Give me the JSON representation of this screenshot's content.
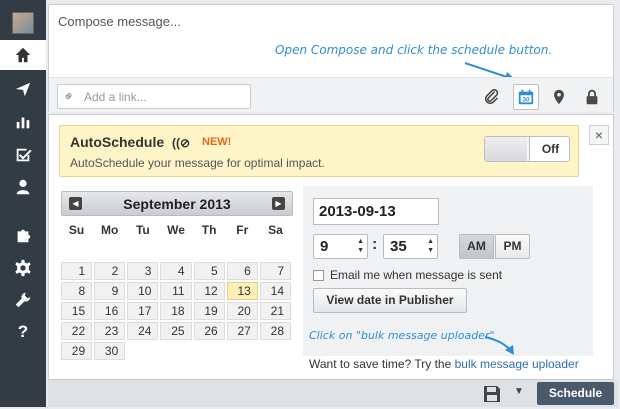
{
  "compose": {
    "placeholder": "Compose message...",
    "hint": "Open Compose and click the schedule button.",
    "link_placeholder": "Add a link..."
  },
  "autoschedule": {
    "title": "AutoSchedule",
    "new_badge": "NEW!",
    "description": "AutoSchedule your message for optimal impact.",
    "toggle_label": "Off"
  },
  "calendar": {
    "month": "September 2013",
    "weekdays": [
      "Su",
      "Mo",
      "Tu",
      "We",
      "Th",
      "Fr",
      "Sa"
    ],
    "weeks": [
      [
        "",
        "",
        "",
        "",
        "",
        "",
        ""
      ],
      [
        "1",
        "2",
        "3",
        "4",
        "5",
        "6",
        "7"
      ],
      [
        "8",
        "9",
        "10",
        "11",
        "12",
        "13",
        "14"
      ],
      [
        "15",
        "16",
        "17",
        "18",
        "19",
        "20",
        "21"
      ],
      [
        "22",
        "23",
        "24",
        "25",
        "26",
        "27",
        "28"
      ],
      [
        "29",
        "30",
        "",
        "",
        "",
        "",
        ""
      ]
    ],
    "selected_day": "13"
  },
  "time": {
    "date": "2013-09-13",
    "hour": "9",
    "minute": "35",
    "am": "AM",
    "pm": "PM",
    "email_label": "Email me when message is sent",
    "view_button": "View date in Publisher"
  },
  "bulk": {
    "hint": "Click on \"bulk message uploader\"",
    "prompt": "Want to save time? Try the",
    "link": "bulk message uploader"
  },
  "footer": {
    "schedule_button": "Schedule"
  },
  "colors": {
    "sidebar": "#333b44",
    "hint": "#2f8ed6",
    "banner": "#fdf4c8",
    "new_badge": "#e06b1a",
    "schedule_button": "#4a5a6b"
  }
}
